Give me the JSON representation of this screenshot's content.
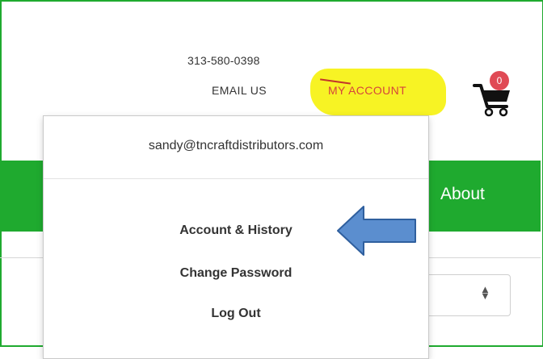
{
  "header": {
    "phone": "313-580-0398",
    "email_us": "EMAIL US",
    "my_account": "MY ACCOUNT",
    "cart_count": "0"
  },
  "nav": {
    "about": "About"
  },
  "dropdown": {
    "user_email": "sandy@tncraftdistributors.com",
    "items": [
      {
        "label": "Account & History"
      },
      {
        "label": "Change Password"
      },
      {
        "label": "Log Out"
      }
    ]
  },
  "colors": {
    "brand_green": "#1faa2f",
    "highlight_yellow": "#f7f324",
    "account_link_red": "#d6453b",
    "badge_red": "#e04a55",
    "annotation_arrow_blue": "#5b8ecf"
  },
  "icons": {
    "cart": "shopping-cart-icon",
    "annotation": "arrow-left-icon",
    "select": "sort-arrows-icon"
  }
}
